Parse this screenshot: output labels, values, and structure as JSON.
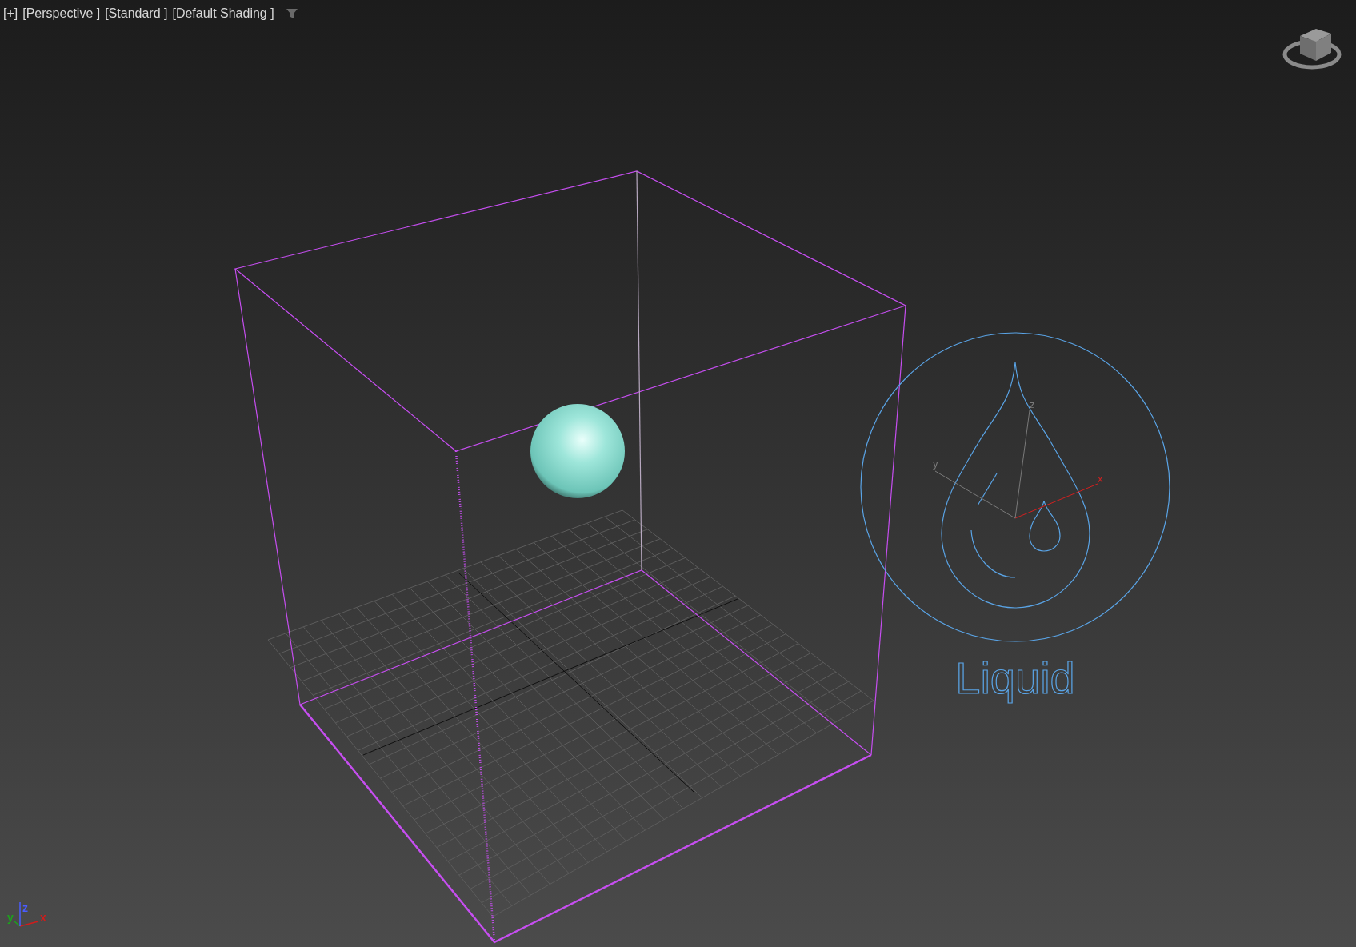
{
  "viewport": {
    "labels": [
      "[+]",
      "[Perspective ]",
      "[Standard ]",
      "[Default Shading ]"
    ]
  },
  "scene": {
    "helper_label": "Liquid",
    "gizmo_axes": [
      {
        "label": "x",
        "color": "#d42020"
      },
      {
        "label": "y",
        "color": "#7a7a7a"
      },
      {
        "label": "z",
        "color": "#7a7a7a"
      }
    ]
  },
  "axis_tripod": [
    {
      "label": "x",
      "color": "#d01c1c"
    },
    {
      "label": "y",
      "color": "#1ea01e"
    },
    {
      "label": "z",
      "color": "#4a5cff"
    }
  ]
}
